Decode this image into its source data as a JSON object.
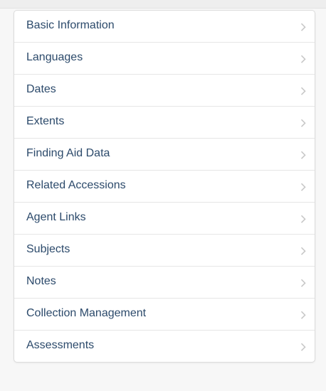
{
  "sidebar": {
    "items": [
      {
        "label": "Basic Information"
      },
      {
        "label": "Languages"
      },
      {
        "label": "Dates"
      },
      {
        "label": "Extents"
      },
      {
        "label": "Finding Aid Data"
      },
      {
        "label": "Related Accessions"
      },
      {
        "label": "Agent Links"
      },
      {
        "label": "Subjects"
      },
      {
        "label": "Notes"
      },
      {
        "label": "Collection Management"
      },
      {
        "label": "Assessments"
      }
    ],
    "item_icon": "chevron-right-icon",
    "colors": {
      "label": "#2c4a6b",
      "chevron": "#c8c8c8",
      "divider": "#e6e6e6",
      "background": "#f7f7f7"
    }
  }
}
